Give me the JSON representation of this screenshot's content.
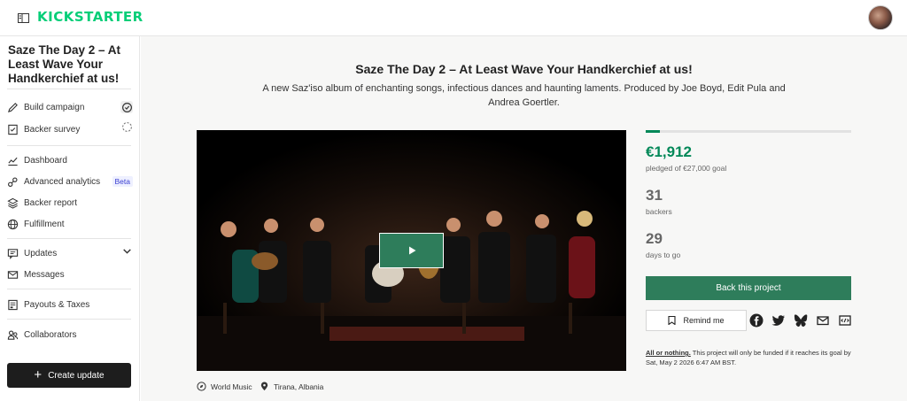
{
  "header": {
    "logo": "KICKSTARTER"
  },
  "sidebar": {
    "project_title": "Saze The Day 2 – At Least Wave Your Handkerchief at us!",
    "items": [
      {
        "label": "Build campaign",
        "icon": "pencil-icon"
      },
      {
        "label": "Backer survey",
        "icon": "survey-icon"
      },
      {
        "label": "Dashboard",
        "icon": "chart-line-icon"
      },
      {
        "label": "Advanced analytics",
        "icon": "analytics-icon",
        "badge": "Beta"
      },
      {
        "label": "Backer report",
        "icon": "layers-icon"
      },
      {
        "label": "Fulfillment",
        "icon": "globe-icon"
      },
      {
        "label": "Updates",
        "icon": "updates-icon"
      },
      {
        "label": "Messages",
        "icon": "mail-icon"
      },
      {
        "label": "Payouts & Taxes",
        "icon": "receipt-icon"
      },
      {
        "label": "Collaborators",
        "icon": "people-icon"
      }
    ],
    "create_update": "Create update"
  },
  "project": {
    "title": "Saze The Day 2 – At Least Wave Your Handkerchief at us!",
    "blurb": "A new Saz'iso album of enchanting songs, infectious dances and haunting laments. Produced by Joe Boyd, Edit Pula and Andrea Goertler.",
    "category": "World Music",
    "location": "Tirana, Albania"
  },
  "stats": {
    "progress_fraction": 0.07,
    "pledged": "€1,912",
    "pledged_goal_text": "pledged of €27,000 goal",
    "backers": "31",
    "backers_label": "backers",
    "days": "29",
    "days_label": "days to go",
    "back_button": "Back this project",
    "remind_button": "Remind me",
    "aon_label": "All or nothing.",
    "aon_text": " This project will only be funded if it reaches its goal by Sat, May 2 2026 6:47 AM BST."
  },
  "colors": {
    "accent": "#028858",
    "button": "#2e7d5b",
    "logo": "#05ce78"
  }
}
